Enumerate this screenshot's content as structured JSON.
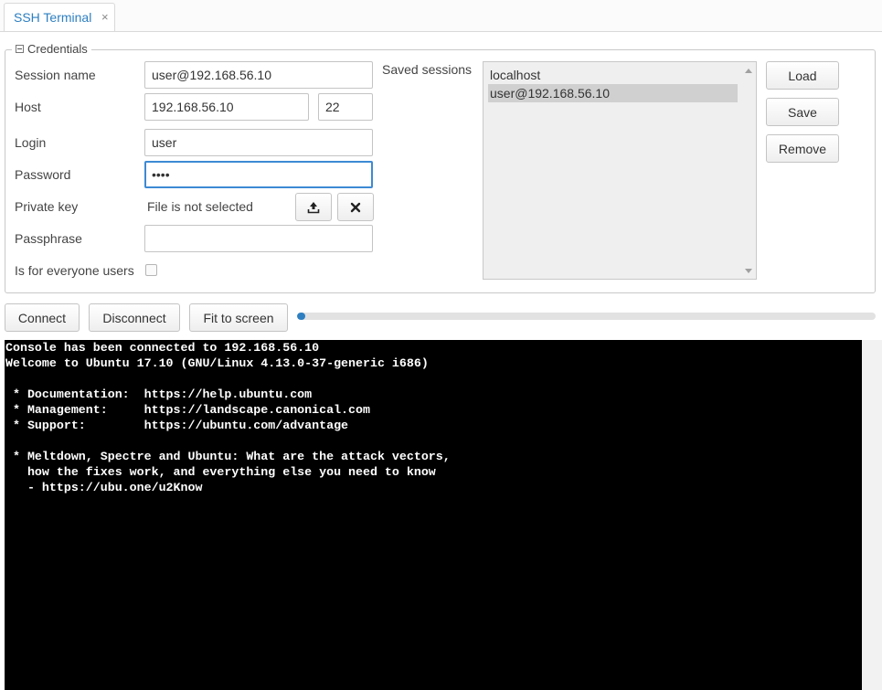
{
  "tab": {
    "label": "SSH Terminal",
    "close": "×"
  },
  "credentials": {
    "legend": "Credentials",
    "session_name_label": "Session name",
    "session_name_value": "user@192.168.56.10",
    "host_label": "Host",
    "host_value": "192.168.56.10",
    "port_value": "22",
    "login_label": "Login",
    "login_value": "user",
    "password_label": "Password",
    "password_value": "••••",
    "private_key_label": "Private key",
    "private_key_value": "File is not selected",
    "passphrase_label": "Passphrase",
    "passphrase_value": "",
    "everyone_label": "Is for everyone users",
    "everyone_checked": false
  },
  "saved_sessions": {
    "label": "Saved sessions",
    "items": [
      "localhost",
      "user@192.168.56.10"
    ],
    "selected_index": 1
  },
  "session_buttons": {
    "load": "Load",
    "save": "Save",
    "remove": "Remove"
  },
  "toolbar": {
    "connect": "Connect",
    "disconnect": "Disconnect",
    "fit": "Fit to screen"
  },
  "progress": {
    "fraction": 0.01
  },
  "colors": {
    "accent": "#2d7fc1",
    "terminal_bg": "#000000",
    "terminal_fg": "#ffffff"
  },
  "icons": {
    "upload": "upload-icon",
    "clear": "close-x-icon",
    "collapse": "collapse-minus-icon"
  },
  "terminal": {
    "lines": [
      "Console has been connected to 192.168.56.10",
      "Welcome to Ubuntu 17.10 (GNU/Linux 4.13.0-37-generic i686)",
      "",
      " * Documentation:  https://help.ubuntu.com",
      " * Management:     https://landscape.canonical.com",
      " * Support:        https://ubuntu.com/advantage",
      "",
      " * Meltdown, Spectre and Ubuntu: What are the attack vectors,",
      "   how the fixes work, and everything else you need to know",
      "   - https://ubu.one/u2Know"
    ]
  }
}
